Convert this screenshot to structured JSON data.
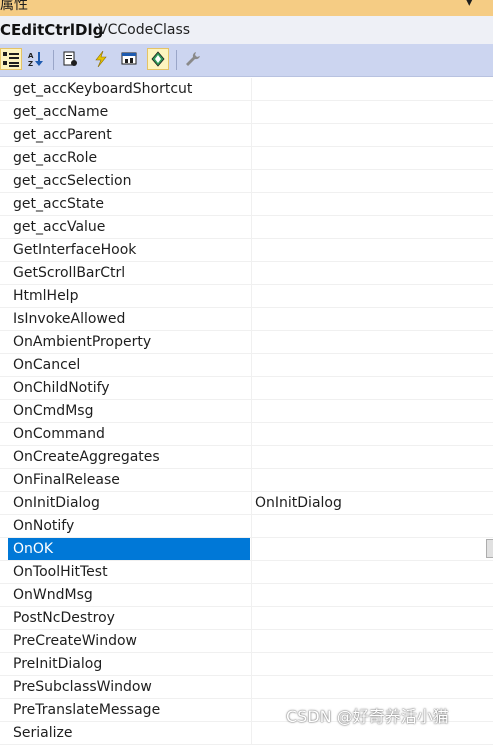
{
  "window": {
    "title": "属性"
  },
  "object_bar": {
    "object_name": "CEditCtrlDlg",
    "object_class": "VCCodeClass"
  },
  "toolbar": {
    "buttons": [
      {
        "icon": "categorized-icon",
        "active": true
      },
      {
        "icon": "alphabetical-icon",
        "active": false
      },
      {
        "icon": "property-pages-icon",
        "active": false
      },
      {
        "icon": "events-icon",
        "active": false
      },
      {
        "icon": "messages-icon",
        "active": false
      },
      {
        "icon": "overrides-icon",
        "active": true
      },
      {
        "icon": "property-wrench-icon",
        "active": false
      }
    ]
  },
  "grid": {
    "rows": [
      {
        "name": "get_accKeyboardShortcut",
        "value": ""
      },
      {
        "name": "get_accName",
        "value": ""
      },
      {
        "name": "get_accParent",
        "value": ""
      },
      {
        "name": "get_accRole",
        "value": ""
      },
      {
        "name": "get_accSelection",
        "value": ""
      },
      {
        "name": "get_accState",
        "value": ""
      },
      {
        "name": "get_accValue",
        "value": ""
      },
      {
        "name": "GetInterfaceHook",
        "value": ""
      },
      {
        "name": "GetScrollBarCtrl",
        "value": ""
      },
      {
        "name": "HtmlHelp",
        "value": ""
      },
      {
        "name": "IsInvokeAllowed",
        "value": ""
      },
      {
        "name": "OnAmbientProperty",
        "value": ""
      },
      {
        "name": "OnCancel",
        "value": ""
      },
      {
        "name": "OnChildNotify",
        "value": ""
      },
      {
        "name": "OnCmdMsg",
        "value": ""
      },
      {
        "name": "OnCommand",
        "value": ""
      },
      {
        "name": "OnCreateAggregates",
        "value": ""
      },
      {
        "name": "OnFinalRelease",
        "value": ""
      },
      {
        "name": "OnInitDialog",
        "value": "OnInitDialog"
      },
      {
        "name": "OnNotify",
        "value": ""
      },
      {
        "name": "OnOK",
        "value": "",
        "selected": true
      },
      {
        "name": "OnToolHitTest",
        "value": ""
      },
      {
        "name": "OnWndMsg",
        "value": ""
      },
      {
        "name": "PostNcDestroy",
        "value": ""
      },
      {
        "name": "PreCreateWindow",
        "value": ""
      },
      {
        "name": "PreInitDialog",
        "value": ""
      },
      {
        "name": "PreSubclassWindow",
        "value": ""
      },
      {
        "name": "PreTranslateMessage",
        "value": ""
      },
      {
        "name": "Serialize",
        "value": ""
      }
    ]
  },
  "watermark": "CSDN @好奇养活小猫",
  "colors": {
    "title_bar": "#f5cc84",
    "toolbar": "#ccd5f0",
    "selection": "#0078d7",
    "active_button": "#fdf4bf"
  }
}
